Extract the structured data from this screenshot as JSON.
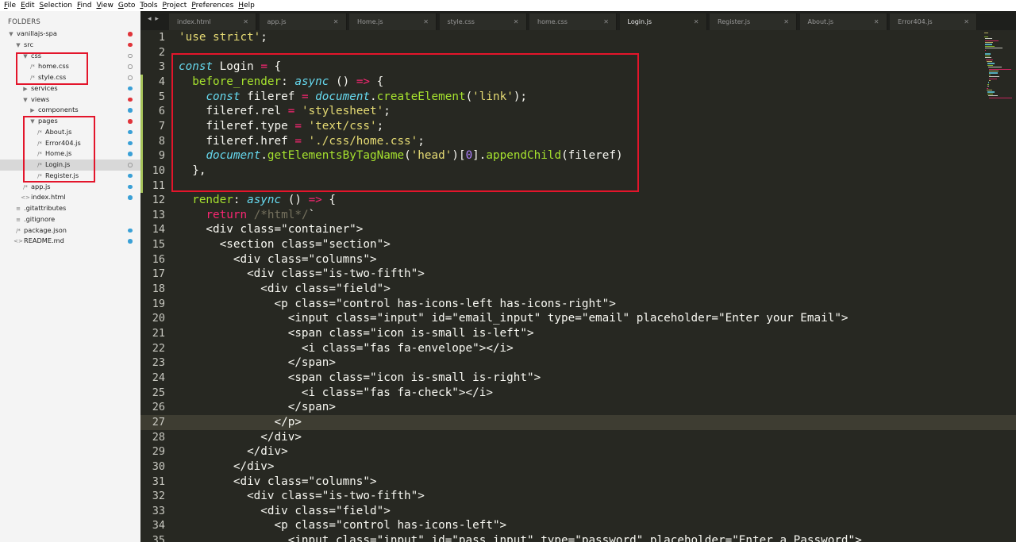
{
  "menu": [
    "File",
    "Edit",
    "Selection",
    "Find",
    "View",
    "Goto",
    "Tools",
    "Project",
    "Preferences",
    "Help"
  ],
  "sidebar": {
    "header": "FOLDERS",
    "tree": [
      {
        "label": "vanillajs-spa",
        "depth": 0,
        "glyph": "▼",
        "dot": "red"
      },
      {
        "label": "src",
        "depth": 1,
        "glyph": "▼",
        "dot": "red"
      },
      {
        "label": "css",
        "depth": 2,
        "glyph": "▼",
        "dot": "hollow"
      },
      {
        "label": "home.css",
        "depth": 3,
        "glyph": "/*",
        "dot": "hollow"
      },
      {
        "label": "style.css",
        "depth": 3,
        "glyph": "/*",
        "dot": "hollow"
      },
      {
        "label": "services",
        "depth": 2,
        "glyph": "▶",
        "dot": "blue"
      },
      {
        "label": "views",
        "depth": 2,
        "glyph": "▼",
        "dot": "red"
      },
      {
        "label": "components",
        "depth": 3,
        "glyph": "▶",
        "dot": "blue"
      },
      {
        "label": "pages",
        "depth": 3,
        "glyph": "▼",
        "dot": "red"
      },
      {
        "label": "About.js",
        "depth": 4,
        "glyph": "/*",
        "dot": "blue"
      },
      {
        "label": "Error404.js",
        "depth": 4,
        "glyph": "/*",
        "dot": "blue"
      },
      {
        "label": "Home.js",
        "depth": 4,
        "glyph": "/*",
        "dot": "blue"
      },
      {
        "label": "Login.js",
        "depth": 4,
        "glyph": "/*",
        "dot": "hollow",
        "selected": true
      },
      {
        "label": "Register.js",
        "depth": 4,
        "glyph": "/*",
        "dot": "blue"
      },
      {
        "label": "app.js",
        "depth": 2,
        "glyph": "/*",
        "dot": "blue"
      },
      {
        "label": "index.html",
        "depth": 2,
        "glyph": "<>",
        "dot": "blue"
      },
      {
        "label": ".gitattributes",
        "depth": 1,
        "glyph": "≡",
        "dot": ""
      },
      {
        "label": ".gitignore",
        "depth": 1,
        "glyph": "≡",
        "dot": ""
      },
      {
        "label": "package.json",
        "depth": 1,
        "glyph": "/*",
        "dot": "blue"
      },
      {
        "label": "README.md",
        "depth": 1,
        "glyph": "<>",
        "dot": "blue"
      }
    ]
  },
  "tabs": {
    "nav": "◂ ▸",
    "items": [
      {
        "label": "index.html",
        "active": false
      },
      {
        "label": "app.js",
        "active": false
      },
      {
        "label": "Home.js",
        "active": false
      },
      {
        "label": "style.css",
        "active": false
      },
      {
        "label": "home.css",
        "active": false
      },
      {
        "label": "Login.js",
        "active": true
      },
      {
        "label": "Register.js",
        "active": false
      },
      {
        "label": "About.js",
        "active": false
      },
      {
        "label": "Error404.js",
        "active": false
      }
    ],
    "close_glyph": "✕"
  },
  "editor": {
    "current_line": 27,
    "lines": [
      [
        [
          "str",
          "'use strict'"
        ],
        [
          "wt",
          ";"
        ]
      ],
      [],
      [
        [
          "k",
          "const"
        ],
        [
          "wt",
          " Login "
        ],
        [
          "kw",
          "="
        ],
        [
          "wt",
          " {"
        ]
      ],
      [
        [
          "wt",
          "  "
        ],
        [
          "fn",
          "before_render"
        ],
        [
          "wt",
          ": "
        ],
        [
          "k",
          "async"
        ],
        [
          "wt",
          " () "
        ],
        [
          "kw",
          "=>"
        ],
        [
          "wt",
          " {"
        ]
      ],
      [
        [
          "wt",
          "    "
        ],
        [
          "k",
          "const"
        ],
        [
          "wt",
          " fileref "
        ],
        [
          "kw",
          "="
        ],
        [
          "wt",
          " "
        ],
        [
          "it",
          "document"
        ],
        [
          "wt",
          "."
        ],
        [
          "prop",
          "createElement"
        ],
        [
          "wt",
          "("
        ],
        [
          "str",
          "'link'"
        ],
        [
          "wt",
          ");"
        ]
      ],
      [
        [
          "wt",
          "    fileref.rel "
        ],
        [
          "kw",
          "="
        ],
        [
          "wt",
          " "
        ],
        [
          "str",
          "'stylesheet'"
        ],
        [
          "wt",
          ";"
        ]
      ],
      [
        [
          "wt",
          "    fileref.type "
        ],
        [
          "kw",
          "="
        ],
        [
          "wt",
          " "
        ],
        [
          "str",
          "'text/css'"
        ],
        [
          "wt",
          ";"
        ]
      ],
      [
        [
          "wt",
          "    fileref.href "
        ],
        [
          "kw",
          "="
        ],
        [
          "wt",
          " "
        ],
        [
          "str",
          "'./css/home.css'"
        ],
        [
          "wt",
          ";"
        ]
      ],
      [
        [
          "wt",
          "    "
        ],
        [
          "it",
          "document"
        ],
        [
          "wt",
          "."
        ],
        [
          "prop",
          "getElementsByTagName"
        ],
        [
          "wt",
          "("
        ],
        [
          "str",
          "'head'"
        ],
        [
          "wt",
          ")["
        ],
        [
          "num",
          "0"
        ],
        [
          "wt",
          "]."
        ],
        [
          "prop",
          "appendChild"
        ],
        [
          "wt",
          "(fileref)"
        ]
      ],
      [
        [
          "wt",
          "  },"
        ]
      ],
      [],
      [
        [
          "wt",
          "  "
        ],
        [
          "fn",
          "render"
        ],
        [
          "wt",
          ": "
        ],
        [
          "k",
          "async"
        ],
        [
          "wt",
          " () "
        ],
        [
          "kw",
          "=>"
        ],
        [
          "wt",
          " {"
        ]
      ],
      [
        [
          "wt",
          "    "
        ],
        [
          "kw",
          "return"
        ],
        [
          "wt",
          " "
        ],
        [
          "cm",
          "/*html*/"
        ],
        [
          "wt",
          "`"
        ]
      ],
      [
        [
          "wt",
          "    <div class=\"container\">"
        ]
      ],
      [
        [
          "wt",
          "      <section class=\"section\">"
        ]
      ],
      [
        [
          "wt",
          "        <div class=\"columns\">"
        ]
      ],
      [
        [
          "wt",
          "          <div class=\"is-two-fifth\">"
        ]
      ],
      [
        [
          "wt",
          "            <div class=\"field\">"
        ]
      ],
      [
        [
          "wt",
          "              <p class=\"control has-icons-left has-icons-right\">"
        ]
      ],
      [
        [
          "wt",
          "                <input class=\"input\" id=\"email_input\" type=\"email\" placeholder=\"Enter your Email\">"
        ]
      ],
      [
        [
          "wt",
          "                <span class=\"icon is-small is-left\">"
        ]
      ],
      [
        [
          "wt",
          "                  <i class=\"fas fa-envelope\"></i>"
        ]
      ],
      [
        [
          "wt",
          "                </span>"
        ]
      ],
      [
        [
          "wt",
          "                <span class=\"icon is-small is-right\">"
        ]
      ],
      [
        [
          "wt",
          "                  <i class=\"fas fa-check\"></i>"
        ]
      ],
      [
        [
          "wt",
          "                </span>"
        ]
      ],
      [
        [
          "wt",
          "              </p>"
        ]
      ],
      [
        [
          "wt",
          "            </div>"
        ]
      ],
      [
        [
          "wt",
          "          </div>"
        ]
      ],
      [
        [
          "wt",
          "        </div>"
        ]
      ],
      [
        [
          "wt",
          "        <div class=\"columns\">"
        ]
      ],
      [
        [
          "wt",
          "          <div class=\"is-two-fifth\">"
        ]
      ],
      [
        [
          "wt",
          "            <div class=\"field\">"
        ]
      ],
      [
        [
          "wt",
          "              <p class=\"control has-icons-left\">"
        ]
      ],
      [
        [
          "wt",
          "                <input class=\"input\" id=\"pass_input\" type=\"password\" placeholder=\"Enter a Password\">"
        ]
      ]
    ]
  }
}
